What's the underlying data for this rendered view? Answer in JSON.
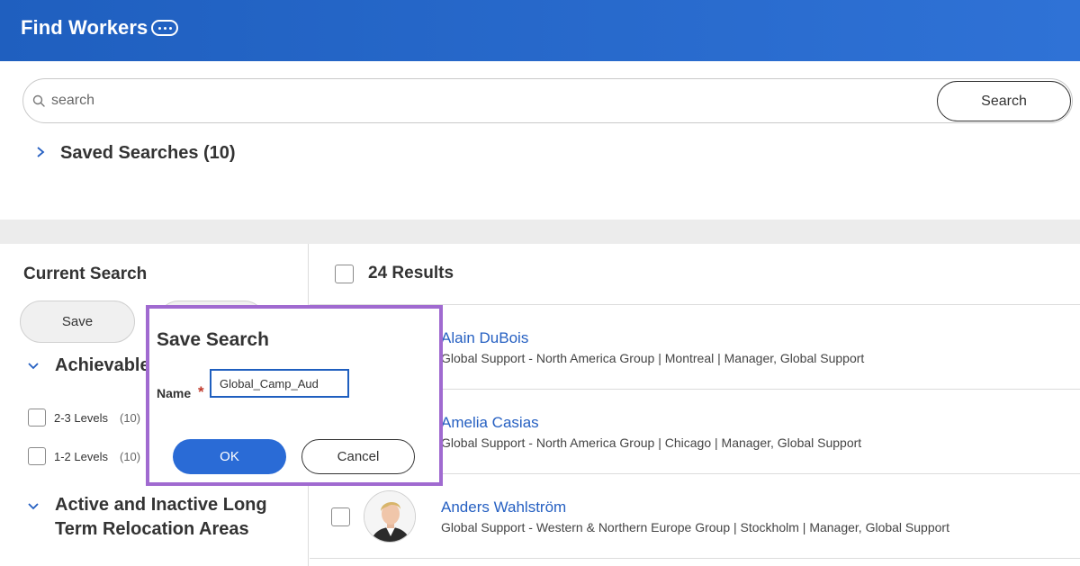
{
  "header": {
    "title": "Find Workers",
    "more_icon": "ellipsis-icon"
  },
  "search": {
    "placeholder": "search",
    "button_label": "Search"
  },
  "saved_searches": {
    "label": "Saved Searches (10)"
  },
  "left_panel": {
    "title": "Current Search",
    "save_label": "Save",
    "facets": [
      {
        "title": "Achievable",
        "items": [
          {
            "label": "2-3 Levels",
            "count": "(10)"
          },
          {
            "label": "1-2 Levels",
            "count": "(10)"
          }
        ]
      },
      {
        "title_line1": "Active and Inactive Long",
        "title_line2": "Term Relocation Areas"
      }
    ]
  },
  "results": {
    "count_label": "24 Results",
    "workers": [
      {
        "name": "Alain DuBois",
        "detail": "Global Support - North America Group | Montreal | Manager, Global Support"
      },
      {
        "name": "Amelia Casias",
        "detail": "Global Support - North America Group | Chicago | Manager, Global Support"
      },
      {
        "name": "Anders Wahlström",
        "detail": "Global Support - Western & Northern Europe Group | Stockholm | Manager, Global Support"
      }
    ]
  },
  "modal": {
    "title": "Save Search",
    "name_label": "Name",
    "required_mark": "*",
    "name_value": "Global_Camp_Aud",
    "ok_label": "OK",
    "cancel_label": "Cancel"
  },
  "colors": {
    "header": "#2566cc",
    "accent": "#2a6bd6",
    "link": "#2660c2",
    "modal_highlight": "#a06ad0",
    "required": "#c0392b"
  }
}
